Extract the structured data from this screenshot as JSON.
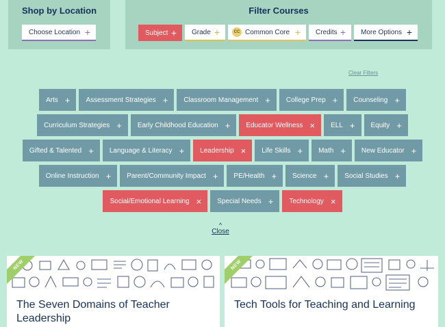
{
  "shop": {
    "title": "Shop by Location",
    "choose_location": "Choose Location"
  },
  "filters": {
    "title": "Filter Courses",
    "subject": "Subject",
    "grade": "Grade",
    "common_core_badge": "CC",
    "common_core": "Common Core",
    "credits": "Credits",
    "more_options": "More Options",
    "clear": "Clear Filters"
  },
  "tags": {
    "rows": [
      [
        {
          "label": "Arts",
          "selected": false
        },
        {
          "label": "Assessment Strategies",
          "selected": false
        },
        {
          "label": "Classroom Management",
          "selected": false
        },
        {
          "label": "College Prep",
          "selected": false
        },
        {
          "label": "Counseling",
          "selected": false
        }
      ],
      [
        {
          "label": "Curriculum Strategies",
          "selected": false
        },
        {
          "label": "Early Childhood Education",
          "selected": false
        },
        {
          "label": "Educator Wellness",
          "selected": true
        },
        {
          "label": "ELL",
          "selected": false
        },
        {
          "label": "Equity",
          "selected": false
        }
      ],
      [
        {
          "label": "Gifted & Talented",
          "selected": false
        },
        {
          "label": "Language & Literacy",
          "selected": false
        },
        {
          "label": "Leadership",
          "selected": true
        },
        {
          "label": "Life Skills",
          "selected": false
        },
        {
          "label": "Math",
          "selected": false
        },
        {
          "label": "New Educator",
          "selected": false
        }
      ],
      [
        {
          "label": "Online Instruction",
          "selected": false
        },
        {
          "label": "Parent/Community Impact",
          "selected": false
        },
        {
          "label": "PE/Health",
          "selected": false
        },
        {
          "label": "Science",
          "selected": false
        },
        {
          "label": "Social Studies",
          "selected": false
        }
      ],
      [
        {
          "label": "Social/Emotional Learning",
          "selected": true
        },
        {
          "label": "Special Needs",
          "selected": false
        },
        {
          "label": "Technology",
          "selected": true
        }
      ]
    ]
  },
  "close_label": "Close",
  "cards": [
    {
      "badge": "NEW",
      "title": "The Seven Domains of Teacher Leadership"
    },
    {
      "badge": "NEW",
      "title": "Tech Tools for Teaching and Learning"
    }
  ],
  "colors": {
    "background": "#c0ebd9",
    "panel": "#a6d4c0",
    "tag": "#6f9aa6",
    "tag_selected": "#e05a5f",
    "navy": "#17325a",
    "ribbon": "#9fcf68"
  }
}
